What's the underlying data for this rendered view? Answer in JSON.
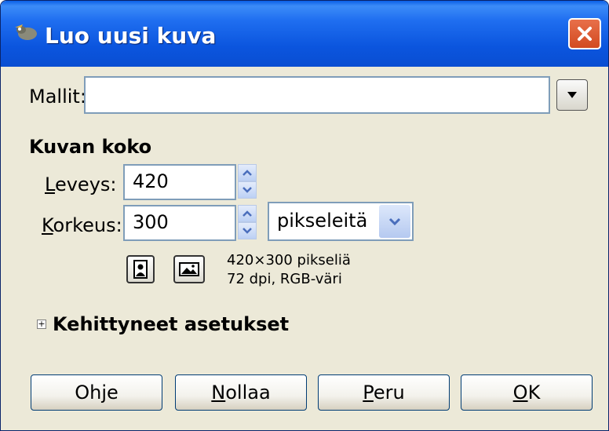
{
  "window": {
    "title": "Luo uusi kuva"
  },
  "template": {
    "label": "Mallit:",
    "value": ""
  },
  "image_size": {
    "heading": "Kuvan koko",
    "width": {
      "label_first": "L",
      "label_rest": "eveys:",
      "value": "420"
    },
    "height": {
      "label_first": "K",
      "label_rest": "orkeus:",
      "value": "300"
    },
    "unit": "pikseleitä",
    "info_line1": "420×300 pikseliä",
    "info_line2": "72 dpi, RGB-väri"
  },
  "advanced": {
    "label": "Kehittyneet asetukset",
    "expander": "+"
  },
  "buttons": {
    "help": {
      "pre": "Oh",
      "ul": "j",
      "post": "e"
    },
    "reset": {
      "pre": "",
      "ul": "N",
      "post": "ollaa"
    },
    "cancel": {
      "pre": "",
      "ul": "P",
      "post": "eru"
    },
    "ok": {
      "pre": "",
      "ul": "O",
      "post": "K"
    }
  },
  "icons": {
    "app": "gimp-wilber-icon",
    "close": "close-icon",
    "template_dropdown": "triangle-down-icon",
    "spin": "spin-up-down-icon",
    "unit_dropdown": "chevron-down-icon",
    "portrait": "portrait-icon",
    "landscape": "landscape-icon"
  },
  "colors": {
    "titlebar": "#0a4ed2",
    "close": "#d24a20",
    "dialog_bg": "#ece9d8"
  }
}
